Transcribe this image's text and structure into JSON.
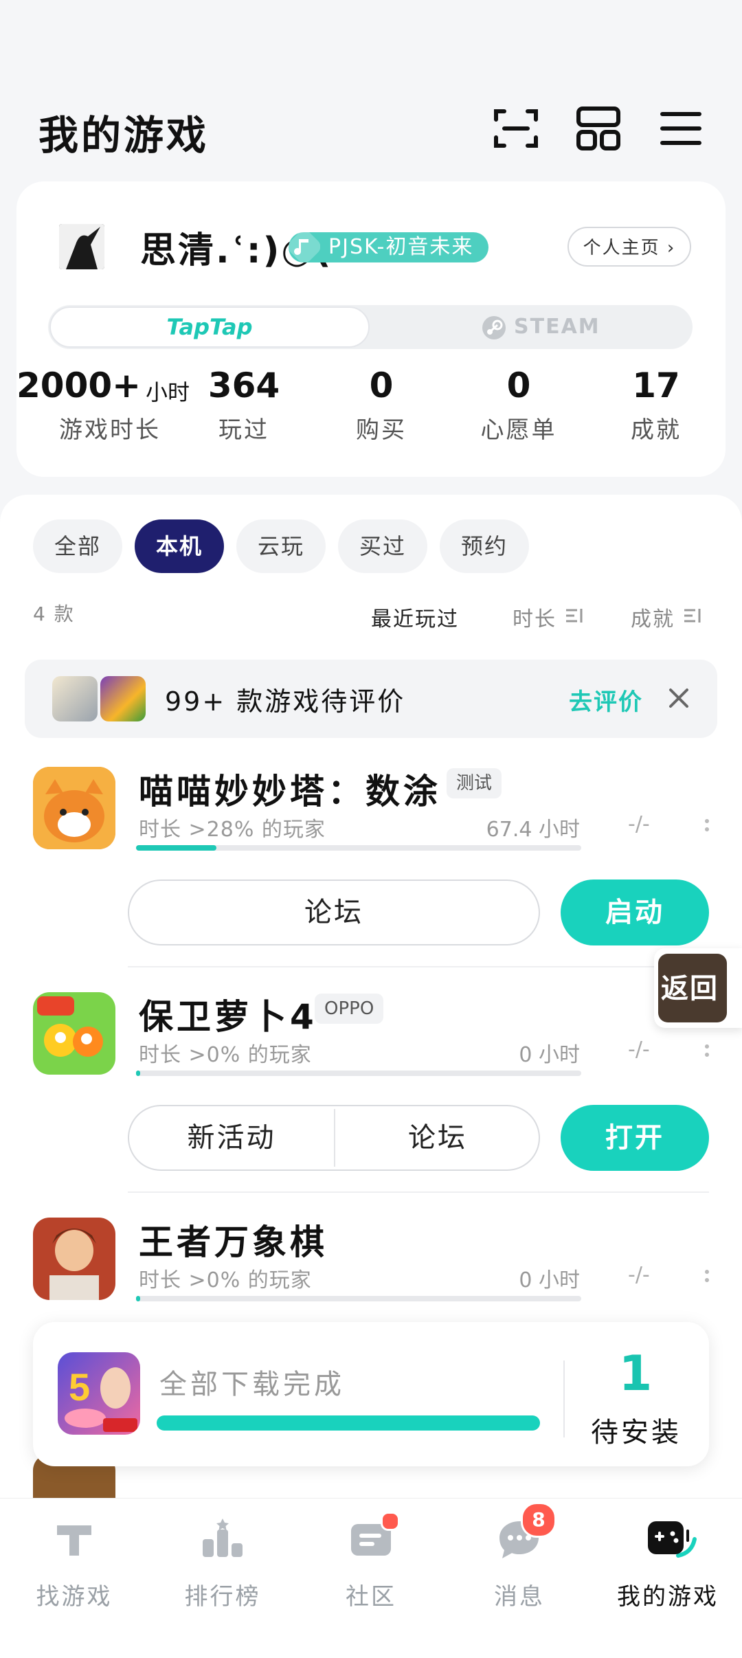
{
  "header": {
    "title": "我的游戏",
    "icons": [
      "scan-icon",
      "layout-grid-icon",
      "menu-icon"
    ]
  },
  "profile": {
    "username": "思清.ʿ:)○(",
    "badge": "PJSK-初音未来",
    "profile_link": "个人主页 ›",
    "platforms": {
      "active": "TapTap",
      "inactive": "STEAM"
    },
    "stats": [
      {
        "value": "2000+",
        "unit": "小时",
        "label": "游戏时长"
      },
      {
        "value": "364",
        "label": "玩过"
      },
      {
        "value": "0",
        "label": "购买"
      },
      {
        "value": "0",
        "label": "心愿单"
      },
      {
        "value": "17",
        "label": "成就"
      }
    ]
  },
  "filters": {
    "chips": [
      "全部",
      "本机",
      "云玩",
      "买过",
      "预约"
    ],
    "selected": "本机",
    "count": "4 款",
    "sort": [
      "最近玩过",
      "时长",
      "成就"
    ]
  },
  "review_banner": {
    "text": "99+ 款游戏待评价",
    "action": "去评价"
  },
  "games": [
    {
      "name": "喵喵妙妙塔：数涂",
      "tag": "测试",
      "percentile": "时长 >28% 的玩家",
      "hours": "67.4 小时",
      "achievements": "-/-",
      "progress": 0.18,
      "buttons": [
        "论坛"
      ],
      "primary": "启动"
    },
    {
      "name": "保卫萝卜4",
      "tag": "OPPO",
      "percentile": "时长 >0% 的玩家",
      "hours": "0 小时",
      "achievements": "-/-",
      "progress": 0.0,
      "buttons": [
        "新活动",
        "论坛"
      ],
      "primary": "打开"
    },
    {
      "name": "王者万象棋",
      "tag": "",
      "percentile": "时长 >0% 的玩家",
      "hours": "0 小时",
      "achievements": "-/-",
      "progress": 0.0
    }
  ],
  "float_button": {
    "label": "返回"
  },
  "download": {
    "status": "全部下载完成",
    "count": "1",
    "count_label": "待安装",
    "progress": 1.0
  },
  "tabbar": {
    "items": [
      {
        "label": "找游戏",
        "icon": "find-games-icon"
      },
      {
        "label": "排行榜",
        "icon": "ranking-icon"
      },
      {
        "label": "社区",
        "icon": "community-icon"
      },
      {
        "label": "消息",
        "icon": "messages-icon",
        "badge": "8"
      },
      {
        "label": "我的游戏",
        "icon": "my-games-icon"
      }
    ],
    "active": "我的游戏"
  },
  "colors": {
    "accent": "#19d2bd",
    "chip_active": "#1f1f6e",
    "badge": "#ff5a4e"
  }
}
